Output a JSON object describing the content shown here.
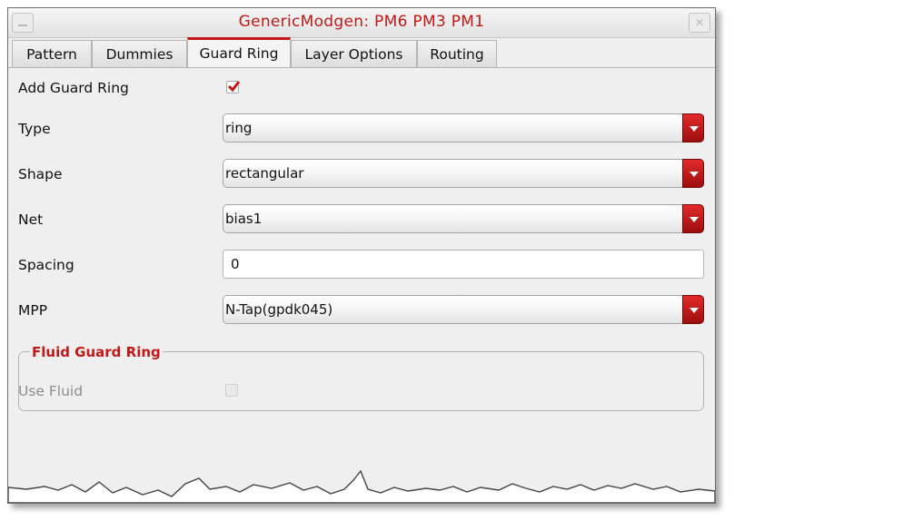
{
  "window": {
    "title": "GenericModgen: PM6 PM3 PM1"
  },
  "tabs": [
    "Pattern",
    "Dummies",
    "Guard Ring",
    "Layer Options",
    "Routing"
  ],
  "active_tab": "Guard Ring",
  "form": {
    "add_guard_ring": {
      "label": "Add Guard Ring",
      "checked": true
    },
    "type": {
      "label": "Type",
      "value": "ring"
    },
    "shape": {
      "label": "Shape",
      "value": "rectangular"
    },
    "net": {
      "label": "Net",
      "value": "bias1"
    },
    "spacing": {
      "label": "Spacing",
      "value": "0"
    },
    "mpp": {
      "label": "MPP",
      "value": "N-Tap(gpdk045)"
    }
  },
  "fluid_group": {
    "title": "Fluid Guard Ring",
    "use_fluid": {
      "label": "Use Fluid",
      "checked": false,
      "enabled": false
    }
  },
  "colors": {
    "accent": "#c41818",
    "dropdown_button": "#c41818"
  },
  "icons": [
    "minimize-icon",
    "close-icon",
    "checkmark-icon",
    "dropdown-arrow-icon"
  ]
}
